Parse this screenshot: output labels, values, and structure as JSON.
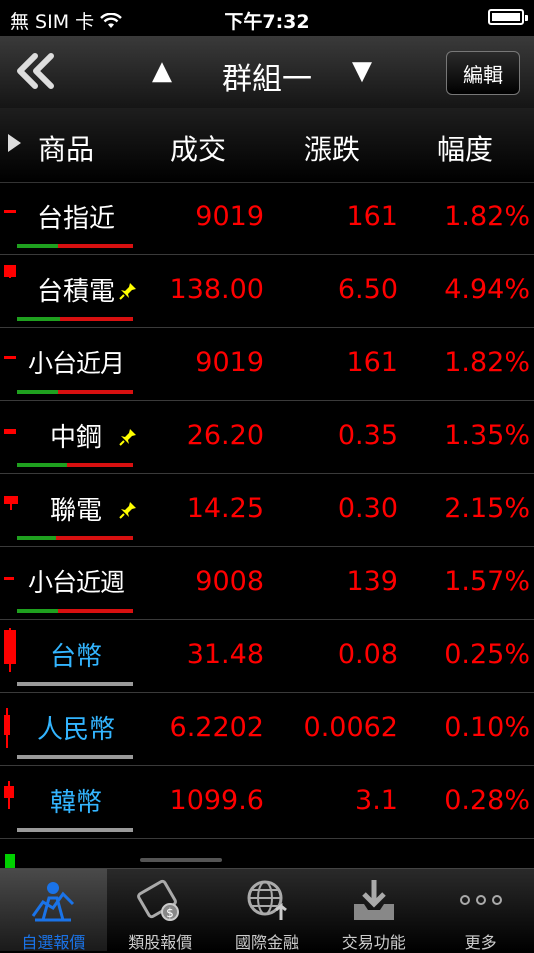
{
  "status_bar": {
    "carrier": "無 SIM 卡",
    "time": "下午7:32",
    "battery_level": 1.0
  },
  "nav": {
    "title": "群組一",
    "edit_label": "編輯"
  },
  "columns": {
    "product": "商品",
    "price": "成交",
    "change": "漲跌",
    "percent": "幅度"
  },
  "rows": [
    {
      "name": "台指近",
      "price": "9019",
      "change": "161",
      "percent": "1.82%",
      "name_color": "#ffffff",
      "pinned": false,
      "bar": "split"
    },
    {
      "name": "台積電",
      "price": "138.00",
      "change": "6.50",
      "percent": "4.94%",
      "name_color": "#ffffff",
      "pinned": true,
      "bar": "split"
    },
    {
      "name": "小台近月",
      "price": "9019",
      "change": "161",
      "percent": "1.82%",
      "name_color": "#ffffff",
      "pinned": false,
      "bar": "split"
    },
    {
      "name": "中鋼",
      "price": "26.20",
      "change": "0.35",
      "percent": "1.35%",
      "name_color": "#ffffff",
      "pinned": true,
      "bar": "split"
    },
    {
      "name": "聯電",
      "price": "14.25",
      "change": "0.30",
      "percent": "2.15%",
      "name_color": "#ffffff",
      "pinned": true,
      "bar": "split"
    },
    {
      "name": "小台近週",
      "price": "9008",
      "change": "139",
      "percent": "1.57%",
      "name_color": "#ffffff",
      "pinned": false,
      "bar": "split"
    },
    {
      "name": "台幣",
      "price": "31.48",
      "change": "0.08",
      "percent": "0.25%",
      "name_color": "#33b5ff",
      "pinned": false,
      "bar": "gray"
    },
    {
      "name": "人民幣",
      "price": "6.2202",
      "change": "0.0062",
      "percent": "0.10%",
      "name_color": "#33b5ff",
      "pinned": false,
      "bar": "gray"
    },
    {
      "name": "韓幣",
      "price": "1099.6",
      "change": "3.1",
      "percent": "0.28%",
      "name_color": "#33b5ff",
      "pinned": false,
      "bar": "gray"
    }
  ],
  "tabs": [
    {
      "label": "自選報價",
      "icon": "watchlist-person-icon",
      "active": true
    },
    {
      "label": "類股報價",
      "icon": "film-coin-icon",
      "active": false
    },
    {
      "label": "國際金融",
      "icon": "globe-icon",
      "active": false
    },
    {
      "label": "交易功能",
      "icon": "download-tray-icon",
      "active": false
    },
    {
      "label": "更多",
      "icon": "more-dots-icon",
      "active": false
    }
  ],
  "colors": {
    "up": "#ff0000",
    "currency_name": "#33b5ff",
    "active_tab": "#1a73e8"
  }
}
